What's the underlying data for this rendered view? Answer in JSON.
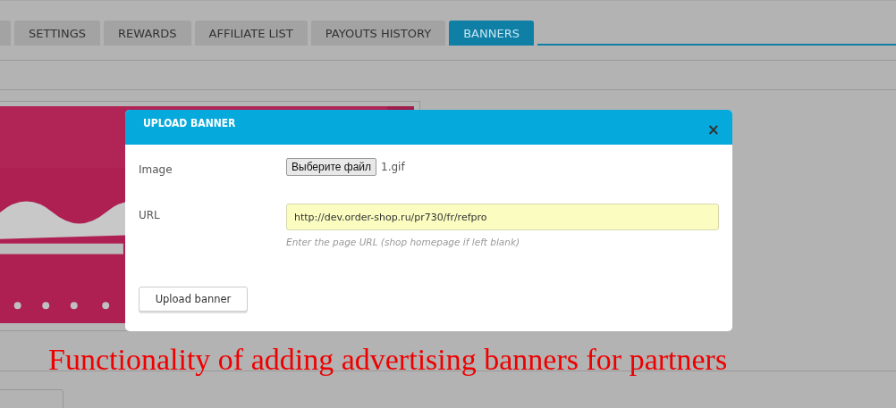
{
  "tabs": [
    {
      "label": "SETTINGS",
      "selected": false
    },
    {
      "label": "REWARDS",
      "selected": false
    },
    {
      "label": "AFFILIATE LIST",
      "selected": false
    },
    {
      "label": "PAYOUTS HISTORY",
      "selected": false
    },
    {
      "label": "BANNERS",
      "selected": true
    }
  ],
  "dialog": {
    "title": "UPLOAD BANNER",
    "close": "×",
    "image_label": "Image",
    "file_button": "Выберите файл",
    "file_name": "1.gif",
    "url_label": "URL",
    "url_value": "http://dev.order-shop.ru/pr730/fr/refpro",
    "url_help": "Enter the page URL (shop homepage if left blank)",
    "submit": "Upload banner"
  },
  "caption": "Functionality of adding advertising banners for partners"
}
